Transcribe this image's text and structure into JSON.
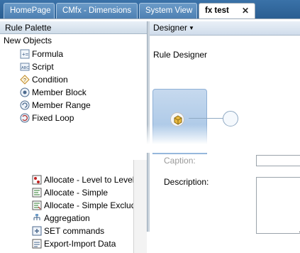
{
  "tabs": [
    {
      "label": "HomePage"
    },
    {
      "label": "CMfx - Dimensions"
    },
    {
      "label": "System View"
    },
    {
      "label": "fx test",
      "close_glyph": "✕"
    }
  ],
  "palette": {
    "header": "Rule Palette",
    "section": "New Objects",
    "objects": [
      {
        "label": "Formula",
        "icon": "formula-icon"
      },
      {
        "label": "Script",
        "icon": "script-icon"
      },
      {
        "label": "Condition",
        "icon": "condition-icon"
      },
      {
        "label": "Member Block",
        "icon": "member-block-icon"
      },
      {
        "label": "Member Range",
        "icon": "member-range-icon"
      },
      {
        "label": "Fixed Loop",
        "icon": "fixed-loop-icon"
      }
    ],
    "system_templates": [
      {
        "label": "Allocate - Level to Level",
        "icon": "allocate-level-icon"
      },
      {
        "label": "Allocate - Simple",
        "icon": "allocate-simple-icon"
      },
      {
        "label": "Allocate - Simple Exclude",
        "icon": "allocate-exclude-icon"
      },
      {
        "label": "Aggregation",
        "icon": "aggregation-icon"
      },
      {
        "label": "SET commands",
        "icon": "set-commands-icon"
      },
      {
        "label": "Export-Import Data",
        "icon": "export-import-icon"
      }
    ]
  },
  "designer": {
    "menu_label": "Designer",
    "title": "Rule Designer",
    "properties": {
      "caption_label": "Caption:",
      "caption_value": "",
      "description_label": "Description:",
      "description_value": ""
    }
  },
  "colors": {
    "tab_bar": "#2a5e92",
    "tab_inactive": "#5a8cbd",
    "panel_header": "#d0dceb",
    "canvas_block": "#b4cfec"
  }
}
